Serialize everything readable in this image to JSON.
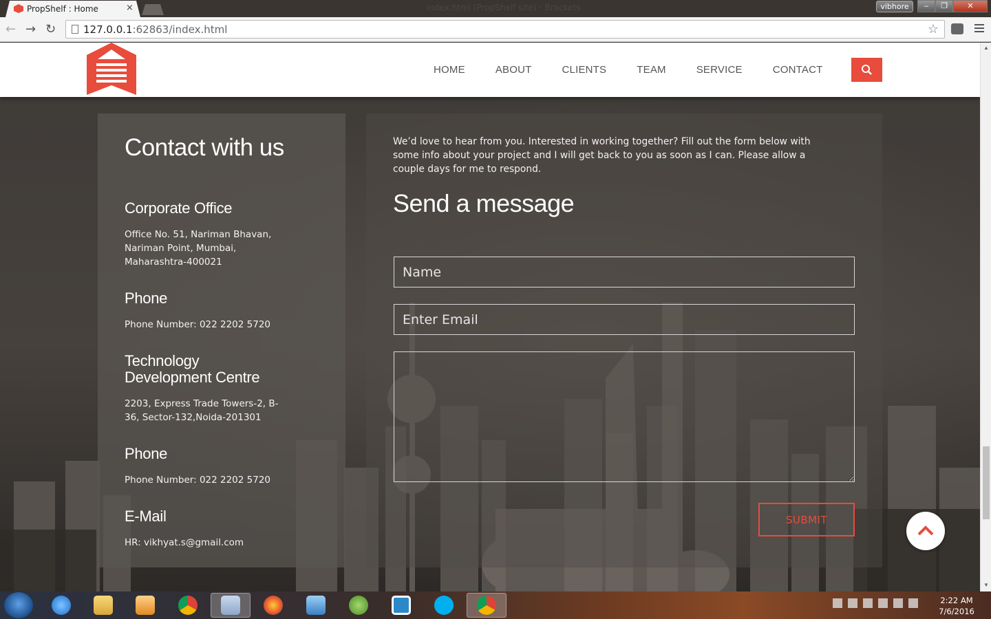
{
  "browser": {
    "tab_title": "PropShelf : Home",
    "tab_close": "×",
    "window_title": "index.html (PropShelf site) - Brackets",
    "user": "vibhore",
    "url_host": "127.0.0.1",
    "url_rest": ":62863/index.html"
  },
  "site": {
    "nav": [
      "HOME",
      "ABOUT",
      "CLIENTS",
      "TEAM",
      "SERVICE",
      "CONTACT"
    ],
    "brand_color": "#e74c3c"
  },
  "contact": {
    "title": "Contact with us",
    "sections": [
      {
        "heading": "Corporate Office",
        "lines": [
          "Office No. 51, Nariman Bhavan,",
          "Nariman Point, Mumbai,",
          "Maharashtra-400021"
        ]
      },
      {
        "heading": "Phone",
        "lines": [
          "Phone Number: 022 2202 5720"
        ]
      },
      {
        "heading_lines": [
          "Technology",
          "Development Centre"
        ],
        "lines": [
          "2203, Express Trade Towers-2, B-",
          "36, Sector-132,Noida-201301"
        ]
      },
      {
        "heading": "Phone",
        "lines": [
          "Phone Number: 022 2202 5720"
        ]
      },
      {
        "heading": "E-Mail",
        "lines": [
          "HR: vikhyat.s@gmail.com"
        ]
      }
    ]
  },
  "form": {
    "intro": "We’d love to hear from you. Interested in working together? Fill out the form below with some info about your project and I will get back to you as soon as I can. Please allow a couple days for me to respond.",
    "title": "Send a message",
    "name_placeholder": "Name",
    "email_placeholder": "Enter Email",
    "message_value": "",
    "submit_label": "SUBMIT"
  },
  "taskbar": {
    "icons": [
      "ie-icon",
      "explorer-icon",
      "media-player-icon",
      "chrome-icon",
      "paint-icon",
      "firefox-icon",
      "control-panel-icon",
      "android-studio-icon",
      "brackets-icon",
      "skype-icon",
      "chrome-user-icon"
    ],
    "time": "2:22 AM",
    "date": "7/6/2016"
  }
}
